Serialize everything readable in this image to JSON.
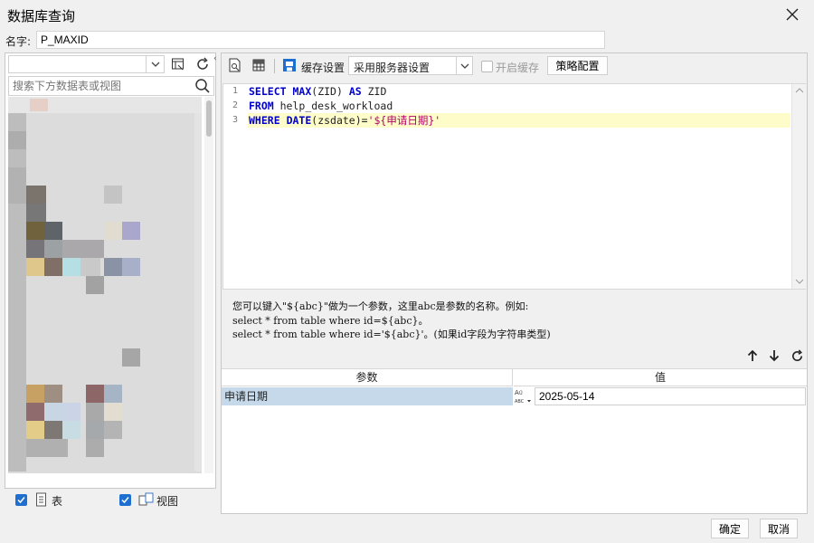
{
  "window": {
    "title": "数据库查询"
  },
  "name_row": {
    "label": "名字:",
    "value": "P_MAXID"
  },
  "left": {
    "search_placeholder": "搜索下方数据表或视图",
    "filters": [
      {
        "label": "表",
        "checked": true
      },
      {
        "label": "视图",
        "checked": true
      }
    ]
  },
  "toolbar": {
    "cache_label": "缓存设置",
    "cache_select_value": "采用服务器设置",
    "enable_cache_label": "开启缓存",
    "enable_cache_checked": false,
    "strategy_button": "策略配置"
  },
  "editor": {
    "line_numbers": [
      "1",
      "2",
      "3"
    ],
    "lines": [
      "SELECT MAX(ZID) AS ZID",
      "FROM help_desk_workload",
      "WHERE DATE(zsdate)='${申请日期}'"
    ]
  },
  "help": {
    "line1": "您可以键入\"${abc}\"做为一个参数，这里abc是参数的名称。例如:",
    "line2": "select * from table where id=${abc}。",
    "line3": "select * from table where id='${abc}'。(如果id字段为字符串类型)"
  },
  "params": {
    "col_name": "参数",
    "col_value": "值",
    "rows": [
      {
        "name": "申请日期",
        "type_icon": "abc-type-icon",
        "value": "2025-05-14"
      }
    ]
  },
  "footer": {
    "ok": "确定",
    "cancel": "取消"
  },
  "colors": {
    "accent": "#1e6fd0",
    "selected_row": "#c5d9ea",
    "highlight_line": "#fefcc8",
    "keyword": "#0000cc",
    "string": "#b3006b"
  }
}
